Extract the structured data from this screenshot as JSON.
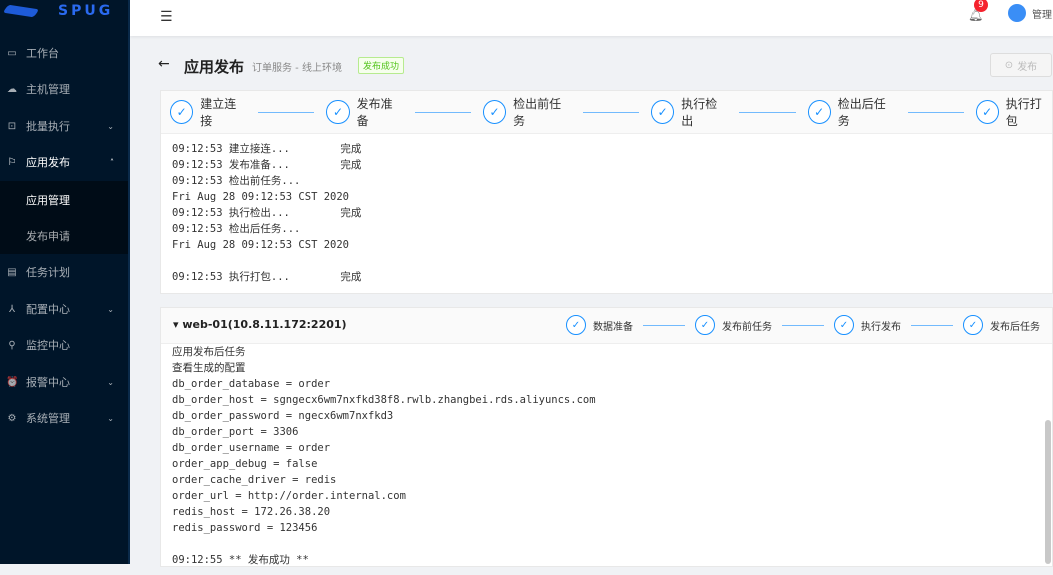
{
  "sidebar": {
    "logo": "SPUG",
    "items": [
      {
        "label": "工作台",
        "icon": "desktop-icon"
      },
      {
        "label": "主机管理",
        "icon": "cloud-server-icon"
      },
      {
        "label": "批量执行",
        "icon": "terminal-icon",
        "arrow": "⌄"
      },
      {
        "label": "应用发布",
        "icon": "flag-icon",
        "arrow": "˄"
      },
      {
        "label": "任务计划",
        "icon": "schedule-icon"
      },
      {
        "label": "配置中心",
        "icon": "apartment-icon",
        "arrow": "⌄"
      },
      {
        "label": "监控中心",
        "icon": "monitor-icon"
      },
      {
        "label": "报警中心",
        "icon": "alarm-icon",
        "arrow": "⌄"
      },
      {
        "label": "系统管理",
        "icon": "setting-icon",
        "arrow": "⌄"
      }
    ],
    "sub": [
      "应用管理",
      "发布申请"
    ]
  },
  "header": {
    "badge": "9",
    "user": "管理"
  },
  "page": {
    "title": "应用发布",
    "subtitle": "订单服务 - 线上环境",
    "tag": "发布成功",
    "publish": "发布"
  },
  "steps": [
    "建立连接",
    "发布准备",
    "检出前任务",
    "执行检出",
    "检出后任务",
    "执行打包"
  ],
  "log1": "09:12:53 建立接连...        完成\n09:12:53 发布准备...        完成\n09:12:53 检出前任务...\nFri Aug 28 09:12:53 CST 2020\n09:12:53 执行检出...        完成\n09:12:53 检出后任务...\nFri Aug 28 09:12:53 CST 2020\n\n09:12:53 执行打包...        完成",
  "host": {
    "name": "web-01(10.8.11.172:2201)",
    "steps": [
      "数据准备",
      "发布前任务",
      "执行发布",
      "发布后任务"
    ],
    "log": "应用发布后任务\n查看生成的配置\ndb_order_database = order\ndb_order_host = sgngecx6wm7nxfkd38f8.rwlb.zhangbei.rds.aliyuncs.com\ndb_order_password = ngecx6wm7nxfkd3\ndb_order_port = 3306\ndb_order_username = order\norder_app_debug = false\norder_cache_driver = redis\norder_url = http://order.internal.com\nredis_host = 172.26.38.20\nredis_password = 123456\n\n09:12:55 ** 发布成功 **"
  }
}
